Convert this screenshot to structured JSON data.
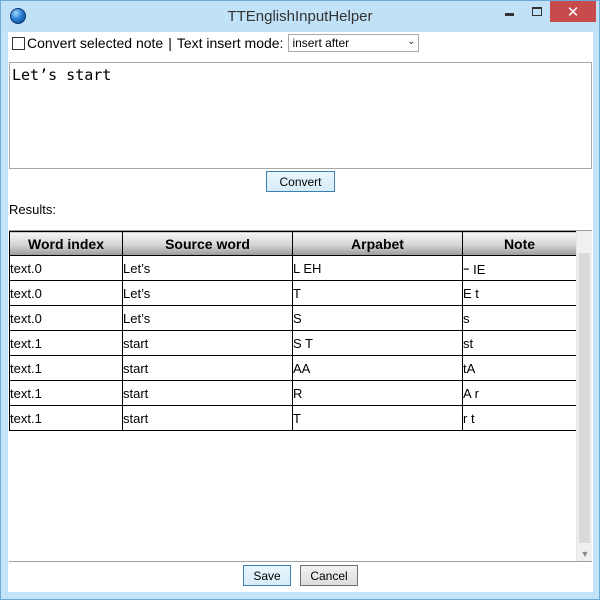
{
  "window": {
    "title": "TTEnglishInputHelper",
    "close_symbol": "✕"
  },
  "toolbar": {
    "convert_selected_label": "Convert selected note",
    "separator": "|",
    "insert_mode_label": "Text insert mode:",
    "insert_mode_value": "insert after",
    "convert_selected_checked": false
  },
  "input": {
    "text": "Let’s start"
  },
  "buttons": {
    "convert": "Convert",
    "save": "Save",
    "cancel": "Cancel"
  },
  "results": {
    "label": "Results:",
    "columns": [
      "Word index",
      "Source word",
      "Arpabet",
      "Note"
    ],
    "rows": [
      [
        "text.0",
        "Let’s",
        "L EH",
        "ｰ IE"
      ],
      [
        "text.0",
        "Let’s",
        "T",
        "E t"
      ],
      [
        "text.0",
        "Let’s",
        "S",
        "s"
      ],
      [
        "text.1",
        "start",
        "S T",
        "st"
      ],
      [
        "text.1",
        "start",
        "AA",
        "tA"
      ],
      [
        "text.1",
        "start",
        "R",
        "A r"
      ],
      [
        "text.1",
        "start",
        "T",
        "r t"
      ]
    ]
  }
}
